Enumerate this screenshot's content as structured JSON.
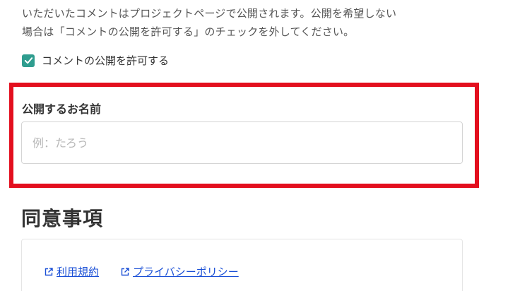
{
  "notice": {
    "line1": "いただいたコメントはプロジェクトページで公開されます。公開を希望しない",
    "line2": "場合は「コメントの公開を許可する」のチェックを外してください。"
  },
  "comment_permission": {
    "label": "コメントの公開を許可する",
    "checked": true,
    "color": "#2f9d8f"
  },
  "public_name": {
    "label": "公開するお名前",
    "placeholder": "例：たろう",
    "value": ""
  },
  "highlight_color": "#e30f1e",
  "agreement": {
    "title": "同意事項",
    "links": [
      {
        "label": "利用規約",
        "icon": "external-link-icon"
      },
      {
        "label": "プライバシーポリシー",
        "icon": "external-link-icon"
      }
    ],
    "link_color": "#1a4fd6"
  }
}
